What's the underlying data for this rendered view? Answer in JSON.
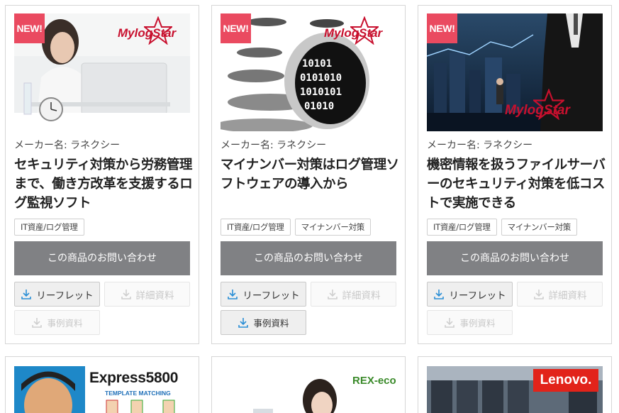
{
  "products": [
    {
      "badge": "NEW!",
      "logo": "MylogStar",
      "maker": "メーカー名: ラネクシー",
      "title": "セキュリティ対策から労務管理まで、働き方改革を支援するログ監視ソフト",
      "tags": [
        "IT資産/ログ管理"
      ],
      "inquiry": "この商品のお問い合わせ",
      "leaflet": "リーフレット",
      "detail": "詳細資料",
      "case": "事例資料",
      "leaflet_enabled": true,
      "detail_enabled": false,
      "case_enabled": false
    },
    {
      "badge": "NEW!",
      "logo": "MylogStar",
      "maker": "メーカー名: ラネクシー",
      "title": "マイナンバー対策はログ管理ソフトウェアの導入から",
      "tags": [
        "IT資産/ログ管理",
        "マイナンバー対策"
      ],
      "inquiry": "この商品のお問い合わせ",
      "leaflet": "リーフレット",
      "detail": "詳細資料",
      "case": "事例資料",
      "leaflet_enabled": true,
      "detail_enabled": false,
      "case_enabled": true
    },
    {
      "badge": "NEW!",
      "logo": "MylogStar",
      "maker": "メーカー名: ラネクシー",
      "title": "機密情報を扱うファイルサーバーのセキュリティ対策を低コストで実施できる",
      "tags": [
        "IT資産/ログ管理",
        "マイナンバー対策"
      ],
      "inquiry": "この商品のお問い合わせ",
      "leaflet": "リーフレット",
      "detail": "詳細資料",
      "case": "事例資料",
      "leaflet_enabled": true,
      "detail_enabled": false,
      "case_enabled": false
    }
  ],
  "row2": [
    {
      "logo": "Express5800",
      "sub": "TEMPLATE MATCHING"
    },
    {
      "logo": "REX-eco"
    },
    {
      "logo": "Lenovo."
    }
  ],
  "colors": {
    "badge": "#ea4a60",
    "inquiry": "#808184",
    "download_icon": "#2b8fd6",
    "logo_red": "#c8102e"
  }
}
